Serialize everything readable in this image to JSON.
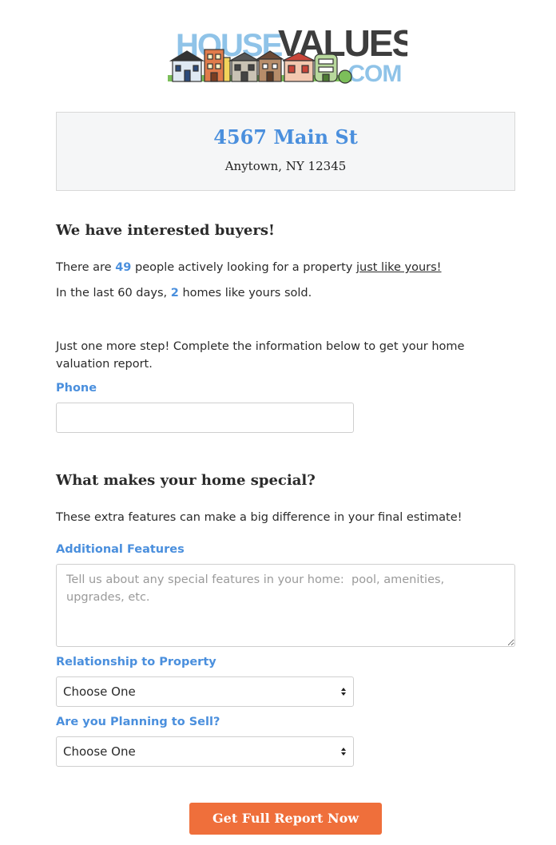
{
  "logo": {
    "word1": "HOUSE",
    "word2": "VALUES",
    "word3": ".COM"
  },
  "property": {
    "street": "4567 Main St",
    "city_line": "Anytown, NY 12345"
  },
  "buyers": {
    "heading": "We have interested buyers!",
    "line1_prefix": "There are ",
    "line1_count": "49",
    "line1_middle": " people actively looking for a property ",
    "line1_link": "just like yours!",
    "line2_prefix": "In the last 60 days, ",
    "line2_count": "2",
    "line2_suffix": " homes like yours sold."
  },
  "step": {
    "text": "Just one more step! Complete the information below to get your home valuation report."
  },
  "phone": {
    "label": "Phone",
    "value": ""
  },
  "special": {
    "heading": "What makes your home special?",
    "text": "These extra features can make a big difference in your final estimate!"
  },
  "features": {
    "label": "Additional Features",
    "placeholder": "Tell us about any special features in your home:  pool, amenities, upgrades, etc."
  },
  "relationship": {
    "label": "Relationship to Property",
    "selected": "Choose One"
  },
  "selling": {
    "label": "Are you Planning to Sell?",
    "selected": "Choose One"
  },
  "cta": {
    "label": "Get Full Report Now"
  },
  "colors": {
    "accent": "#4a8fdd",
    "cta": "#ef6f3b",
    "heading": "#2a2a2a"
  }
}
